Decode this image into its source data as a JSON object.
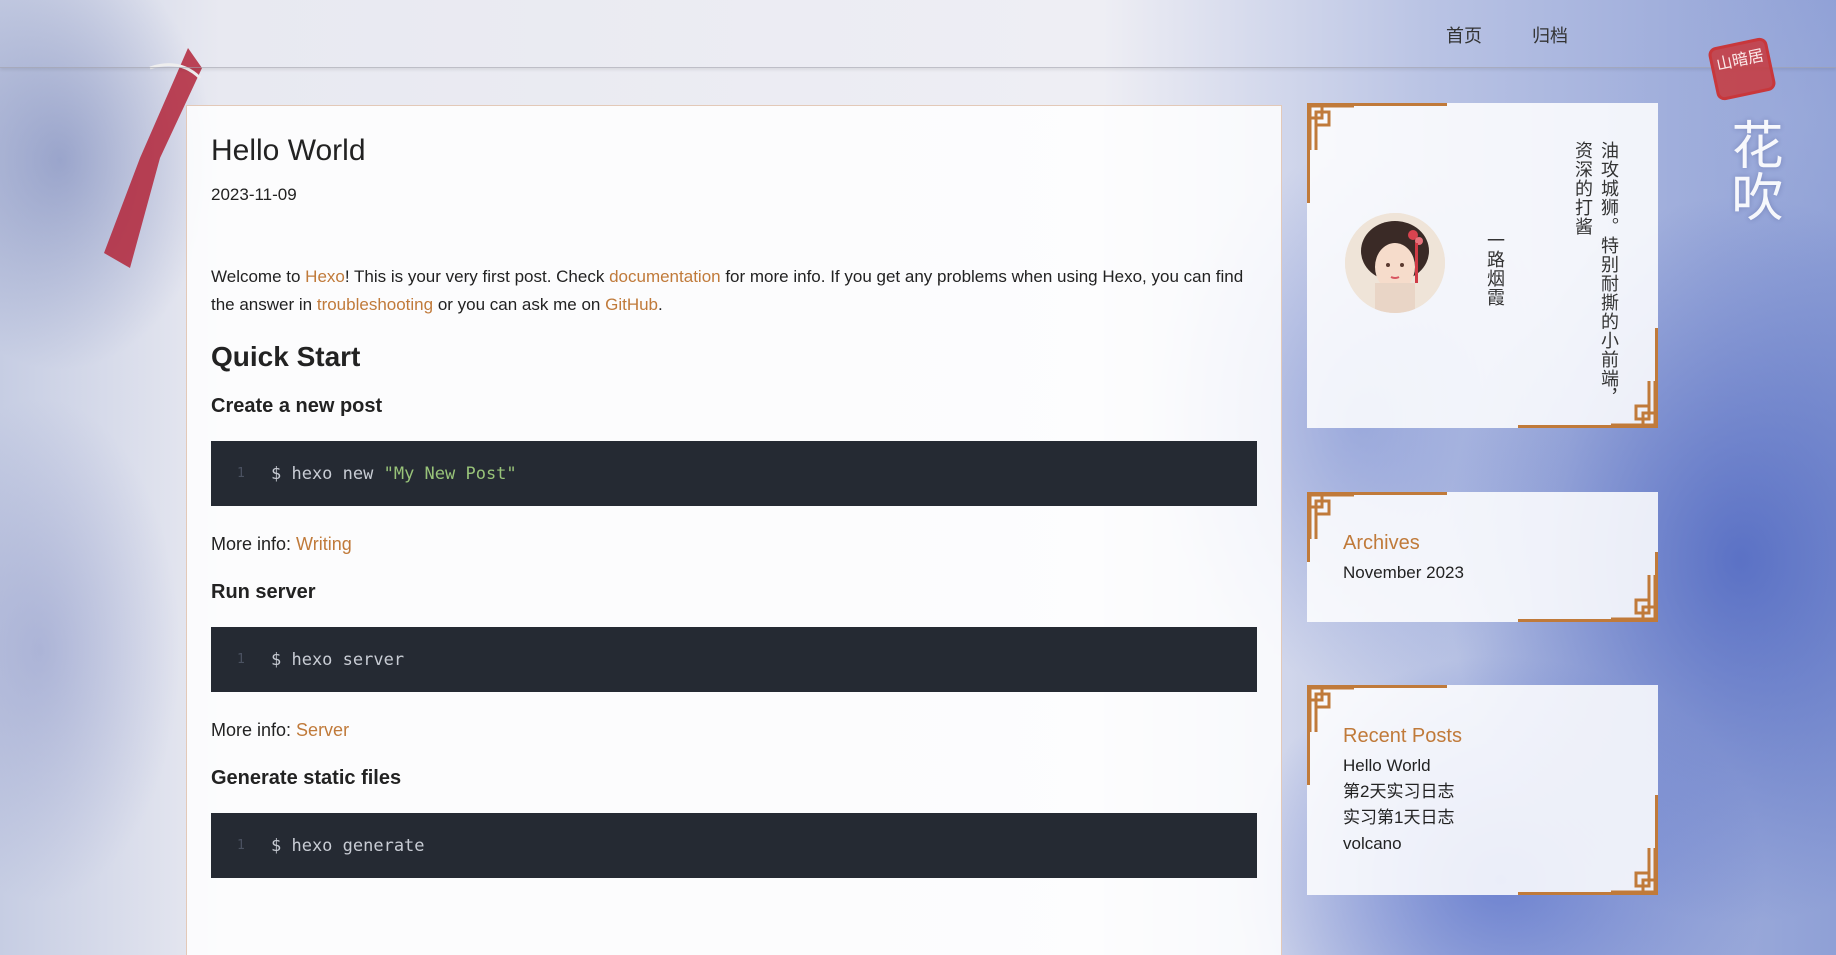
{
  "nav": {
    "items": [
      {
        "label": "首页"
      },
      {
        "label": "归档"
      }
    ]
  },
  "decor": {
    "calligraphy": "花吹",
    "seal_text": "山暗居"
  },
  "post": {
    "title": "Hello World",
    "date": "2023-11-09",
    "intro": {
      "p1": "Welcome to ",
      "link1": "Hexo",
      "p2": "! This is your very first post. Check ",
      "link2": "documentation",
      "p3": " for more info. If you get any problems when using Hexo, you can find the answer in ",
      "link3": "troubleshooting",
      "p4": " or you can ask me on ",
      "link4": "GitHub",
      "p5": "."
    },
    "quick_start": "Quick Start",
    "sections": [
      {
        "heading": "Create a new post",
        "line_no": "1",
        "code_cmd": "$ hexo new ",
        "code_str": "\"My New Post\"",
        "more_label": "More info: ",
        "more_link": "Writing"
      },
      {
        "heading": "Run server",
        "line_no": "1",
        "code_cmd": "$ hexo server",
        "code_str": "",
        "more_label": "More info: ",
        "more_link": "Server"
      },
      {
        "heading": "Generate static files",
        "line_no": "1",
        "code_cmd": "$ hexo generate",
        "code_str": ""
      }
    ]
  },
  "profile": {
    "bio": "油攻城狮。特别耐撕的小前端，资深的打酱",
    "name": "一路烟霞"
  },
  "archives": {
    "title": "Archives",
    "items": [
      "November 2023"
    ]
  },
  "recent_posts": {
    "title": "Recent Posts",
    "items": [
      "Hello World",
      "第2天实习日志",
      "实习第1天日志",
      "volcano"
    ]
  },
  "colors": {
    "accent": "#c07a3a",
    "code_bg": "#252a33",
    "code_string": "#98c379",
    "seal_red": "#c8373b"
  }
}
